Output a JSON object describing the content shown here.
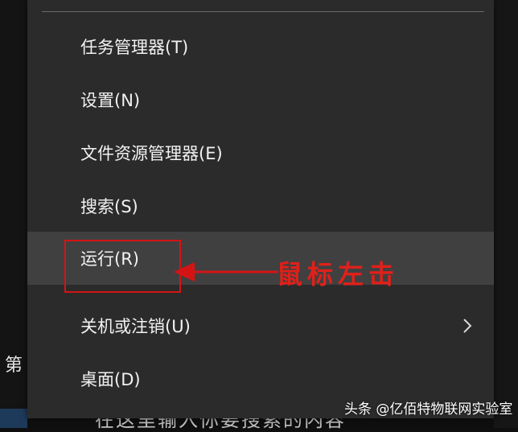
{
  "menu": {
    "items": [
      {
        "label": "任务管理器(T)"
      },
      {
        "label": "设置(N)"
      },
      {
        "label": "文件资源管理器(E)"
      },
      {
        "label": "搜索(S)"
      },
      {
        "label": "运行(R)",
        "highlighted": true
      },
      {
        "label": "关机或注销(U)",
        "has_submenu": true
      },
      {
        "label": "桌面(D)"
      }
    ]
  },
  "annotation": {
    "text": "鼠标左击",
    "color": "#e0201a"
  },
  "backdrop": {
    "left_text": "第",
    "bottom_text": "在这里输入你要搜索的内容"
  },
  "watermark": {
    "text": "头条 @亿佰特物联网实验室"
  },
  "colors": {
    "menu_bg": "#2b2b2b",
    "highlight_bg": "#404040",
    "annotation_red": "#d41414"
  },
  "icons": {
    "submenu": "chevron-right-icon",
    "pointer": "arrow-left-icon"
  }
}
